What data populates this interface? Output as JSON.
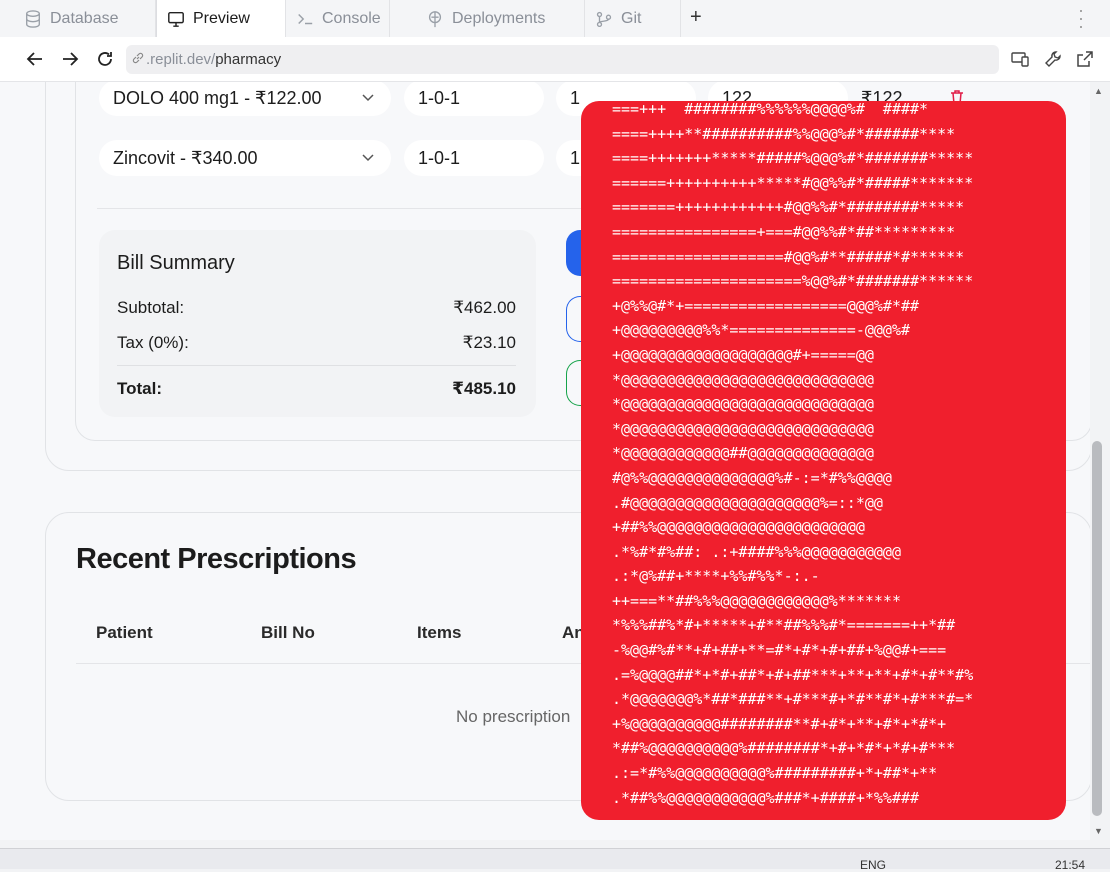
{
  "tabs": [
    {
      "label": "Database",
      "icon": "database-icon"
    },
    {
      "label": "Preview",
      "icon": "monitor-icon",
      "active": true
    },
    {
      "label": "Console",
      "icon": "terminal-icon"
    },
    {
      "label": "Deployments",
      "icon": "globe-icon"
    },
    {
      "label": "Git",
      "icon": "git-icon"
    }
  ],
  "new_tab": "+",
  "url": {
    "prefix": ".replit.dev/",
    "path": "pharmacy"
  },
  "items": [
    {
      "medicine": "DOLO 400 mg1 - ₹122.00",
      "dosage": "1-0-1",
      "qty": "1",
      "price": "122",
      "total": "₹122"
    },
    {
      "medicine": "Zincovit - ₹340.00",
      "dosage": "1-0-1",
      "qty": "1"
    }
  ],
  "bill": {
    "title": "Bill Summary",
    "subtotal_label": "Subtotal:",
    "subtotal": "₹462.00",
    "tax_label": "Tax (0%):",
    "tax": "₹23.10",
    "total_label": "Total:",
    "total": "₹485.10"
  },
  "recent": {
    "title": "Recent Prescriptions",
    "columns": [
      "Patient",
      "Bill No",
      "Items",
      "An"
    ],
    "empty": "No prescription"
  },
  "overlay_lines": [
    "===+++  ########%%%%%%@@@@%#  ####*",
    "====++++**##########%%@@@%#*######****",
    "====+++++++*****#####%@@@%#*#######*****",
    "======++++++++++*****#@@%%#*#####*******",
    "=======++++++++++++#@@%%#*########*****",
    "================+===#@@%%#*##*********",
    "===================#@@%#**#####*#******",
    "=====================%@@%#*#######******",
    "+@%%@#*+==================@@@%#*##",
    "+@@@@@@@@@%%*==============-@@@%#",
    "+@@@@@@@@@@@@@@@@@@@#+=====@@",
    "*@@@@@@@@@@@@@@@@@@@@@@@@@@@@",
    "*@@@@@@@@@@@@@@@@@@@@@@@@@@@@",
    "*@@@@@@@@@@@@@@@@@@@@@@@@@@@@",
    "*@@@@@@@@@@@@##@@@@@@@@@@@@@@",
    "#@%%@@@@@@@@@@@@@@%#-:=*#%%@@@@",
    ".#@@@@@@@@@@@@@@@@@@@@@%=::*@@",
    "+##%%@@@@@@@@@@@@@@@@@@@@@@@",
    ".*%#*#%##: .:+####%%%@@@@@@@@@@@",
    ".:*@%##+****+%%#%%*-:.-",
    "++===**##%%%@@@@@@@@@@@@%*******",
    "*%%%##%*#+*****+#**##%%%#*=======++*##",
    "-%@@#%#**+#+##+**=#*+#*+#+##+%@@#+===",
    ".=%@@@@##*+*#+##*+#+##***+**+**+#*+#**#%",
    ".*@@@@@@@%*##*###**+#***#+*#**#*+#***#=*",
    "+%@@@@@@@@@@########**#+#*+**+#*+*#*+",
    "*##%@@@@@@@@@@%########*+#+*#*+*#+#***",
    ".:=*#%%@@@@@@@@@@%#########+*+##*+**",
    ".*##%%@@@@@@@@@@@%###*+####+*%%###"
  ],
  "taskbar": {
    "lang": "ENG",
    "time": "21:54"
  }
}
